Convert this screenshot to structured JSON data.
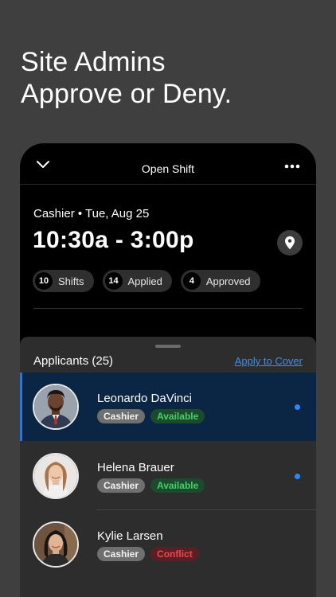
{
  "headline": {
    "line1": "Site Admins",
    "line2": "Approve or Deny."
  },
  "screen": {
    "title": "Open Shift",
    "shift_info": "Cashier • Tue, Aug 25",
    "shift_time": "10:30a - 3:00p",
    "stats": [
      {
        "count": "10",
        "label": "Shifts"
      },
      {
        "count": "14",
        "label": "Applied"
      },
      {
        "count": "4",
        "label": "Approved"
      }
    ]
  },
  "applicants": {
    "title": "Applicants (25)",
    "apply_link": "Apply to Cover",
    "items": [
      {
        "name": "Leonardo DaVinci",
        "role": "Cashier",
        "status": "Available"
      },
      {
        "name": "Helena Brauer",
        "role": "Cashier",
        "status": "Available"
      },
      {
        "name": "Kylie Larsen",
        "role": "Cashier",
        "status": "Conflict"
      }
    ]
  },
  "colors": {
    "accent": "#2f86f5",
    "available": "#46cf6c",
    "conflict": "#f0474f",
    "background": "#3f3f3f"
  },
  "icons": [
    "chevron-down-icon",
    "more-icon",
    "map-pin-icon"
  ]
}
